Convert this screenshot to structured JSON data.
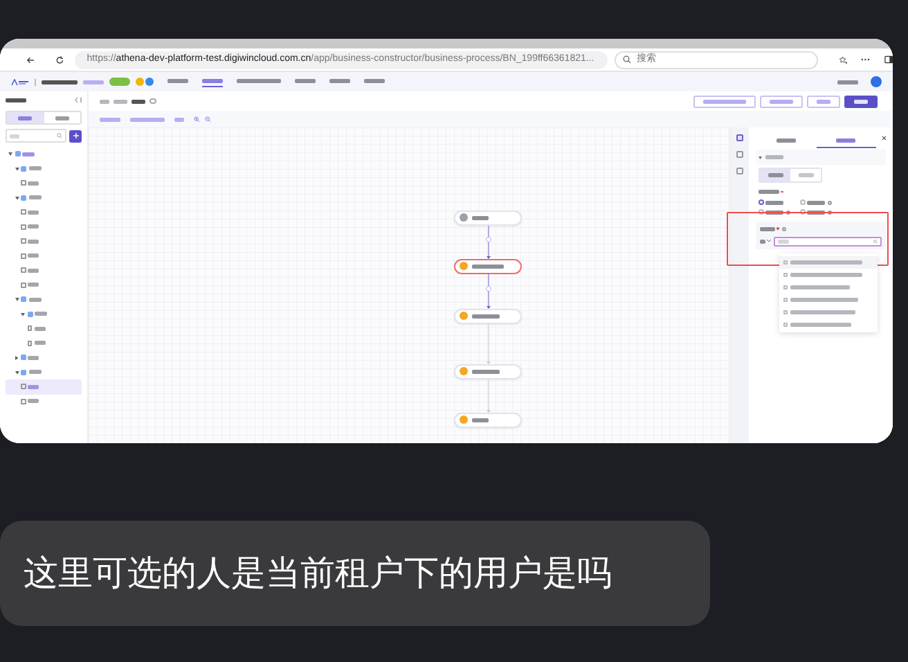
{
  "browser": {
    "url_scheme": "https://",
    "url_host": "athena-dev-platform-test.digiwincloud.com.cn",
    "url_path": "/app/business-constructor/business-process/BN_199ff66361821...",
    "search_placeholder": "搜索"
  },
  "app_header": {
    "nav": [
      {
        "selected": false
      },
      {
        "selected": true
      },
      {
        "selected": false
      },
      {
        "selected": false
      },
      {
        "selected": false
      },
      {
        "selected": false
      }
    ]
  },
  "sidebar": {
    "tabs": [
      {
        "selected": true
      },
      {
        "selected": false
      }
    ],
    "tree": [
      {
        "expanded": true,
        "selected": false,
        "children": [
          {
            "expanded": true,
            "selected": false,
            "children": [
              {
                "selected": false
              }
            ]
          },
          {
            "expanded": true,
            "selected": false,
            "children": [
              {
                "selected": false
              },
              {
                "selected": false
              },
              {
                "selected": false
              },
              {
                "selected": false
              },
              {
                "selected": false
              },
              {
                "selected": false
              }
            ]
          },
          {
            "expanded": true,
            "selected": false,
            "children": [
              {
                "expanded": true,
                "selected": false,
                "children": [
                  {
                    "selected": false
                  },
                  {
                    "selected": false
                  }
                ]
              }
            ]
          },
          {
            "expanded": false,
            "selected": false
          },
          {
            "expanded": true,
            "selected": false,
            "children": [
              {
                "selected": true
              },
              {
                "selected": false
              }
            ]
          }
        ]
      }
    ]
  },
  "buttons": [
    {
      "kind": "outline"
    },
    {
      "kind": "outline"
    },
    {
      "kind": "outline"
    },
    {
      "kind": "primary"
    }
  ],
  "nodes": [
    {
      "kind": "start",
      "selected": false
    },
    {
      "kind": "user",
      "selected": true,
      "incoming_active": true
    },
    {
      "kind": "user",
      "selected": false,
      "incoming_active": true
    },
    {
      "kind": "user",
      "selected": false,
      "incoming_active": false
    },
    {
      "kind": "user",
      "selected": false,
      "incoming_active": false
    }
  ],
  "panel": {
    "tabs": [
      {
        "selected": false
      },
      {
        "selected": true
      }
    ],
    "segments": [
      {
        "selected": true
      },
      {
        "selected": false
      }
    ],
    "radios": [
      {
        "selected": true
      },
      {
        "selected": false,
        "help": true
      },
      {
        "selected": false,
        "help": true
      },
      {
        "selected": false,
        "help": true
      }
    ],
    "options": [
      {
        "checked": false
      },
      {
        "checked": false
      },
      {
        "checked": false
      },
      {
        "checked": false
      },
      {
        "checked": false
      },
      {
        "checked": false
      }
    ]
  },
  "message": "这里可选的人是当前租户下的用户是吗"
}
